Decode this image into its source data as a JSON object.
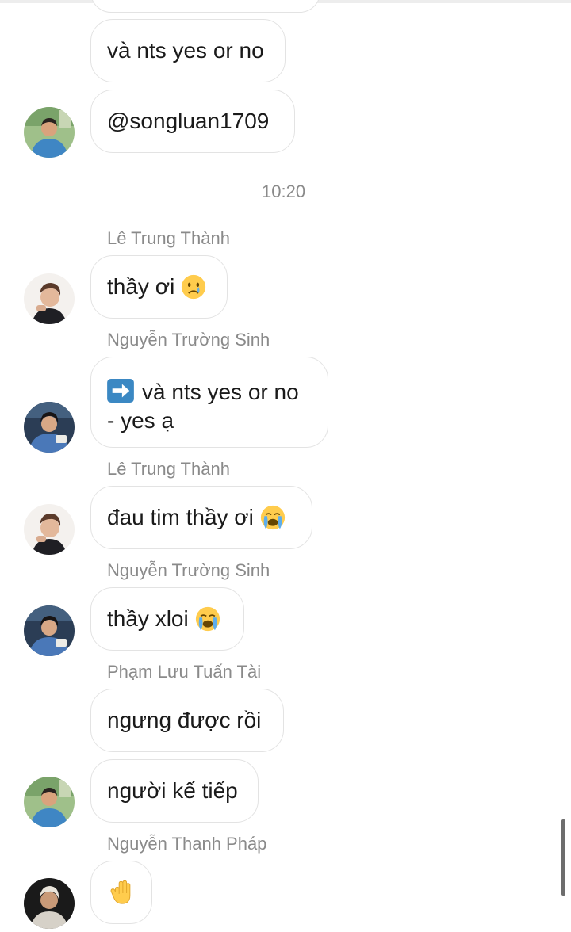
{
  "messages": {
    "m1": "và nts yes or no",
    "m2": "@songluan1709",
    "m3": "thầy ơi",
    "m4_line1": "và nts yes or no",
    "m4_line2": "- yes ạ",
    "m5": "đau tim thầy ơi",
    "m6": "thầy xloi",
    "m7": "ngưng được rồi",
    "m8": "người kế tiếp"
  },
  "timestamp": "10:20",
  "senders": {
    "s1": "Lê Trung Thành",
    "s2": "Nguyễn Trường Sinh",
    "s3": "Lê Trung Thành",
    "s4": "Nguyễn Trường Sinh",
    "s5": "Phạm Lưu Tuấn Tài",
    "s6": "Nguyễn Thanh Pháp"
  },
  "icons": {
    "crying": "crying-face-icon",
    "loud_crying": "loudly-crying-face-icon",
    "arrow": "right-arrow-icon",
    "hand": "raised-hand-icon"
  },
  "colors": {
    "bubble_border": "#e3e3e3",
    "meta_text": "#8a8a8a",
    "arrow_blue": "#3b88c3",
    "emoji_yellow": "#ffcc4d",
    "tear_blue": "#5dadec"
  }
}
